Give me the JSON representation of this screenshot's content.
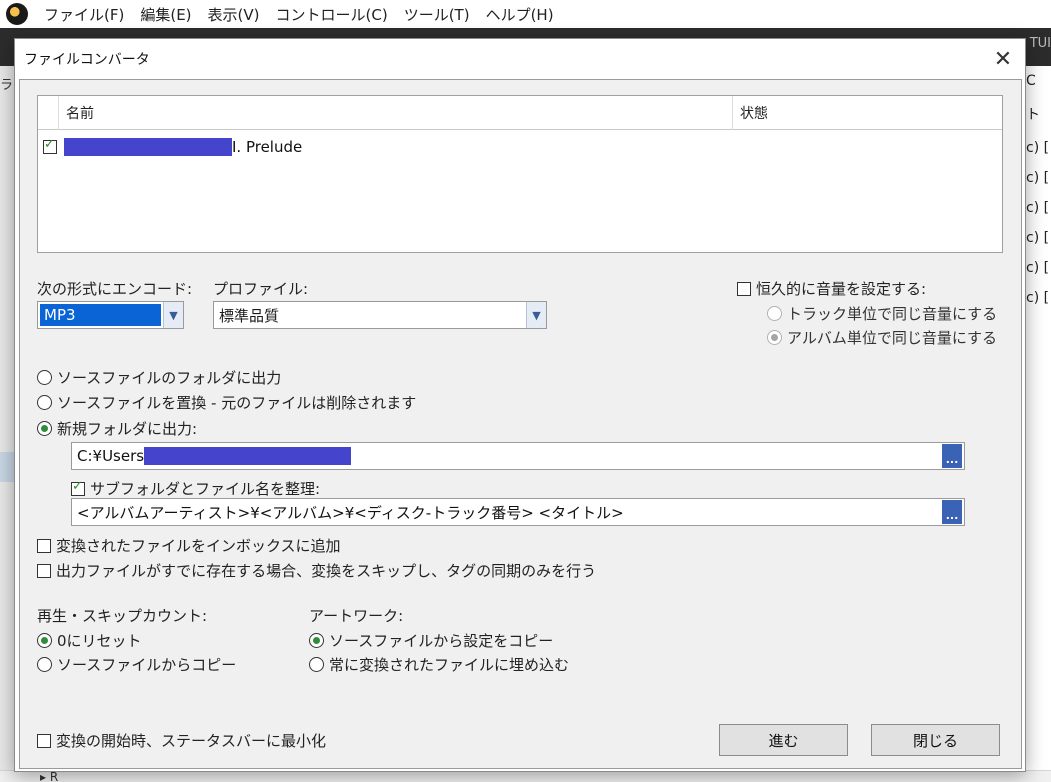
{
  "app": {
    "menu": [
      {
        "label": "ファイル(F)"
      },
      {
        "label": "編集(E)"
      },
      {
        "label": "表示(V)"
      },
      {
        "label": "コントロール(C)"
      },
      {
        "label": "ツール(T)"
      },
      {
        "label": "ヘルプ(H)"
      }
    ],
    "band_text": "TUI",
    "left_letter": "ラ",
    "right_rows": [
      "C",
      "ト",
      "c) [",
      "c) [",
      "c) [",
      "c) [",
      "c) [",
      "c) ["
    ],
    "bottom_text": "▸ R"
  },
  "dialog": {
    "title": "ファイルコンバータ",
    "close_label": "✕",
    "list": {
      "columns": [
        "名前",
        "状態"
      ],
      "rows": [
        {
          "checked": true,
          "title": "I. Prelude",
          "status": ""
        }
      ]
    },
    "encode": {
      "label": "次の形式にエンコード:",
      "value": "MP3"
    },
    "profile": {
      "label": "プロファイル:",
      "value": "標準品質"
    },
    "volume": {
      "label": "恒久的に音量を設定する:",
      "checked": false,
      "options": [
        {
          "label": "トラック単位で同じ音量にする",
          "selected": false
        },
        {
          "label": "アルバム単位で同じ音量にする",
          "selected": true
        }
      ]
    },
    "output": {
      "options": [
        {
          "label": "ソースファイルのフォルダに出力",
          "selected": false
        },
        {
          "label": "ソースファイルを置換 - 元のファイルは削除されます",
          "selected": false
        },
        {
          "label": "新規フォルダに出力:",
          "selected": true
        }
      ],
      "path_prefix": "C:¥Users",
      "browse_label": "...",
      "organize_label": "サブフォルダとファイル名を整理:",
      "organize_checked": true,
      "pattern": "<アルバムアーティスト>¥<アルバム>¥<ディスク-トラック番号> <タイトル>"
    },
    "add_inbox": {
      "label": "変換されたファイルをインボックスに追加",
      "checked": false
    },
    "skip_existing": {
      "label": "出力ファイルがすでに存在する場合、変換をスキップし、タグの同期のみを行う",
      "checked": false
    },
    "playcount": {
      "label": "再生・スキップカウント:",
      "options": [
        {
          "label": "0にリセット",
          "selected": true
        },
        {
          "label": "ソースファイルからコピー",
          "selected": false
        }
      ]
    },
    "artwork": {
      "label": "アートワーク:",
      "options": [
        {
          "label": "ソースファイルから設定をコピー",
          "selected": true
        },
        {
          "label": "常に変換されたファイルに埋め込む",
          "selected": false
        }
      ]
    },
    "minimize": {
      "label": "変換の開始時、ステータスバーに最小化",
      "checked": false
    },
    "proceed_label": "進む",
    "close_button_label": "閉じる"
  },
  "colors": {
    "redaction": "#4444cc",
    "selection": "#0a64d6",
    "radio_on": "#2f8c3a",
    "check_on": "#2a8a2a"
  }
}
